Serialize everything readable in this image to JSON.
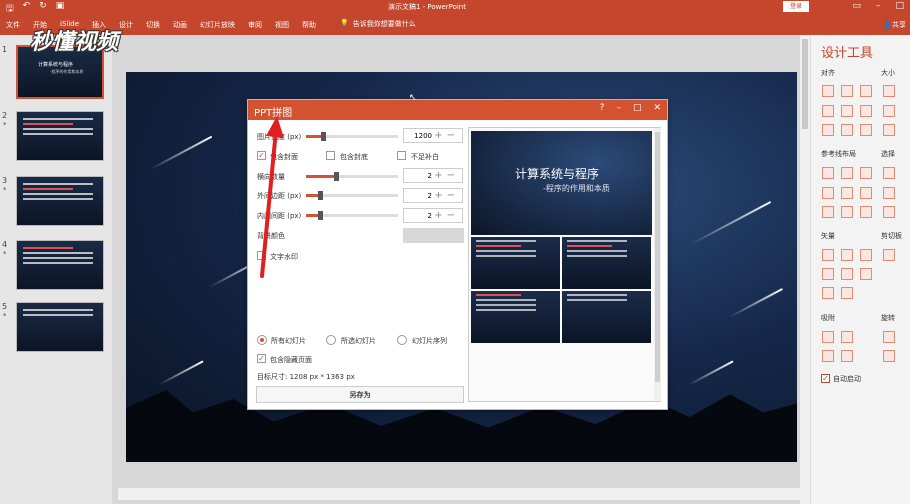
{
  "titlebar": {
    "doc_title": "演示文稿1 - PowerPoint",
    "login_label": "登录",
    "share_label": "共享"
  },
  "ribbon": {
    "tabs": [
      "文件",
      "开始",
      "iSlide",
      "插入",
      "设计",
      "切换",
      "动画",
      "幻灯片放映",
      "审阅",
      "视图",
      "帮助"
    ],
    "tell_me": "告诉我你想要做什么"
  },
  "thumbnails": [
    {
      "num": "1",
      "star": "",
      "title": "计算系统与程序",
      "subtitle": "-程序的作用和本质"
    },
    {
      "num": "2",
      "star": "*",
      "title": "",
      "subtitle": ""
    },
    {
      "num": "3",
      "star": "*",
      "title": "",
      "subtitle": ""
    },
    {
      "num": "4",
      "star": "*",
      "title": "",
      "subtitle": ""
    },
    {
      "num": "5",
      "star": "*",
      "title": "",
      "subtitle": ""
    }
  ],
  "dialog": {
    "title": "PPT拼图",
    "image_width_label": "图片宽度 (px)",
    "image_width_value": "1200",
    "image_width_fraction": 0.18,
    "include_cover_label": "包含封面",
    "include_cover_checked": true,
    "include_back_label": "包含封底",
    "include_back_checked": false,
    "no_fill_label": "不足补白",
    "no_fill_checked": false,
    "columns_label": "横向数量",
    "columns_value": "2",
    "outer_margin_label": "外间边距 (px)",
    "outer_margin_value": "2",
    "inner_margin_label": "内间间距 (px)",
    "inner_margin_value": "2",
    "bg_color_label": "背景颜色",
    "watermark_label": "文字水印",
    "watermark_checked": false,
    "radio_all": "所有幻灯片",
    "radio_selected": "所选幻灯片",
    "radio_sequence": "幻灯片序列",
    "radio_value": "all",
    "include_hidden_label": "包含隐藏页面",
    "include_hidden_checked": true,
    "target_size": "目标尺寸:  1208 px *  1363 px",
    "save_label": "另存为",
    "preview_title": "计算系统与程序",
    "preview_subtitle": "-程序的作用和本质"
  },
  "right_panel": {
    "title": "设计工具",
    "sections": {
      "align": "对齐",
      "size": "大小",
      "guides": "参考线布局",
      "select": "选择",
      "vector": "矢量",
      "clipboard": "剪切板",
      "snap": "吸附",
      "rotate": "旋转"
    },
    "autostart_label": "自动启动",
    "autostart_checked": true
  },
  "watermark_text": "秒懂视频",
  "colors": {
    "accent": "#c4462c",
    "dialog_accent": "#d35230"
  }
}
